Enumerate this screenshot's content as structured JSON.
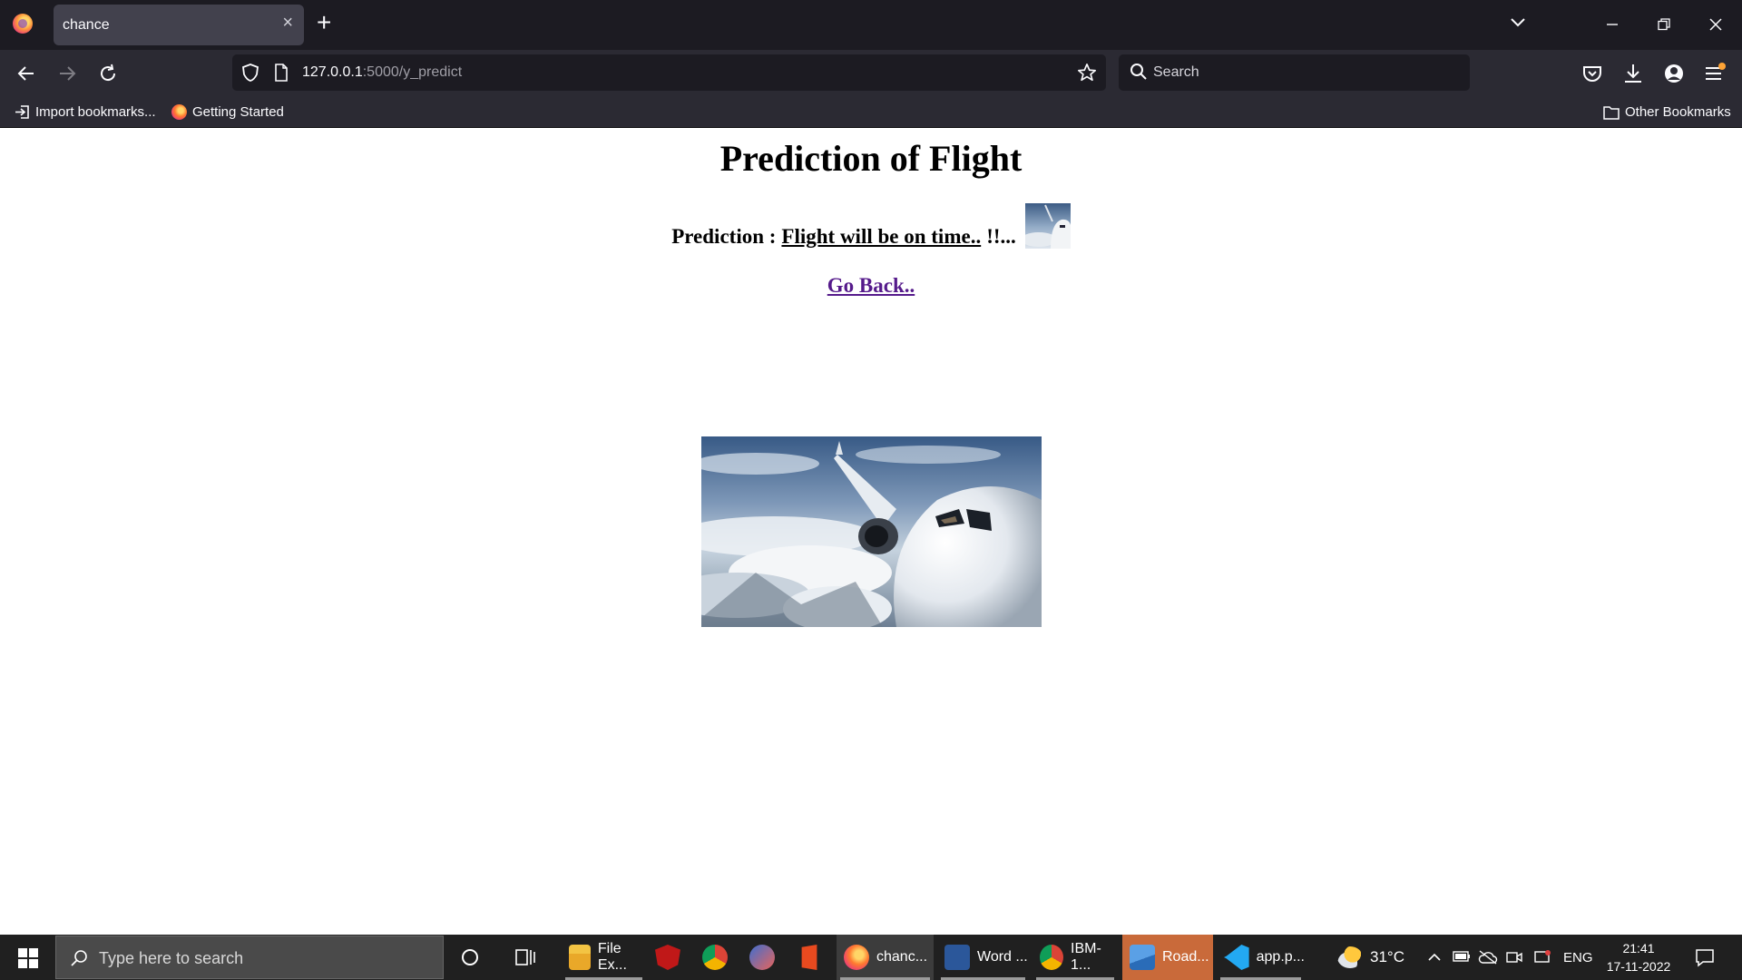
{
  "browser": {
    "tab_title": "chance",
    "tab_close": "×",
    "new_tab": "+",
    "url_host": "127.0.0.1",
    "url_path": ":5000/y_predict",
    "search_placeholder": "Search",
    "bookmarks": [
      {
        "label": "Import bookmarks...",
        "icon": "import-icon"
      },
      {
        "label": "Getting Started",
        "icon": "firefox-icon"
      }
    ],
    "other_bookmarks": "Other Bookmarks"
  },
  "page": {
    "title": "Prediction of Flight",
    "prediction_label": "Prediction :",
    "prediction_result": "Flight will be on time..",
    "prediction_suffix": "!!...",
    "go_back": "Go Back.."
  },
  "taskbar": {
    "search_placeholder": "Type here to search",
    "apps": [
      {
        "label": "File Ex...",
        "icon": "file-explorer-icon"
      },
      {
        "label": "",
        "icon": "mcafee-icon"
      },
      {
        "label": "",
        "icon": "chrome-icon"
      },
      {
        "label": "",
        "icon": "snipping-tool-icon"
      },
      {
        "label": "",
        "icon": "office-icon"
      },
      {
        "label": "chanc...",
        "icon": "firefox-icon"
      },
      {
        "label": "Word ...",
        "icon": "word-icon"
      },
      {
        "label": "IBM-1...",
        "icon": "chrome-icon"
      },
      {
        "label": "Road...",
        "icon": "photos-icon"
      },
      {
        "label": "app.p...",
        "icon": "vscode-icon"
      }
    ],
    "weather": "31°C",
    "language": "ENG",
    "time": "21:41",
    "date": "17-11-2022"
  },
  "colors": {
    "link_visited": "#551a8b",
    "tab_active": "#42414d",
    "toolbar": "#2b2a33",
    "taskbar": "#202020"
  }
}
